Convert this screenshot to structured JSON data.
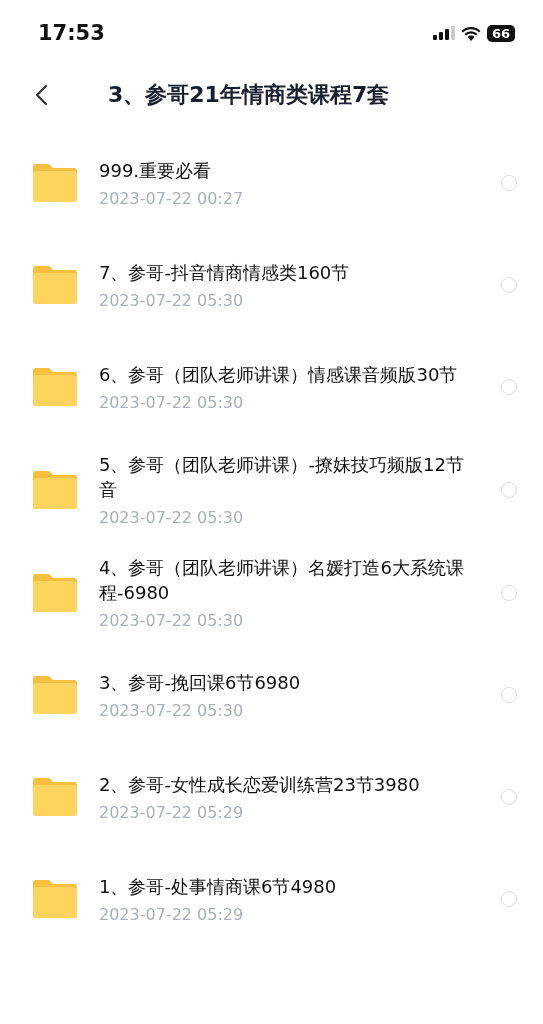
{
  "status_bar": {
    "time": "17:53",
    "battery": "66"
  },
  "header": {
    "title": "3、参哥21年情商类课程7套"
  },
  "files": [
    {
      "name": "999.重要必看",
      "date": "2023-07-22 00:27",
      "selected": false
    },
    {
      "name": "7、参哥-抖音情商情感类160节",
      "date": "2023-07-22 05:30",
      "selected": false
    },
    {
      "name": "6、参哥（团队老师讲课）情感课音频版30节",
      "date": "2023-07-22 05:30",
      "selected": false
    },
    {
      "name": "5、参哥（团队老师讲课）-撩妹技巧频版12节音",
      "date": "2023-07-22 05:30",
      "selected": false
    },
    {
      "name": "4、参哥（团队老师讲课）名媛打造6大系统课程-6980",
      "date": "2023-07-22 05:30",
      "selected": false
    },
    {
      "name": "3、参哥-挽回课6节6980",
      "date": "2023-07-22 05:30",
      "selected": false
    },
    {
      "name": "2、参哥-女性成长恋爱训练营23节3980",
      "date": "2023-07-22 05:29",
      "selected": false
    },
    {
      "name": "1、参哥-处事情商课6节4980",
      "date": "2023-07-22 05:29",
      "selected": false
    }
  ]
}
